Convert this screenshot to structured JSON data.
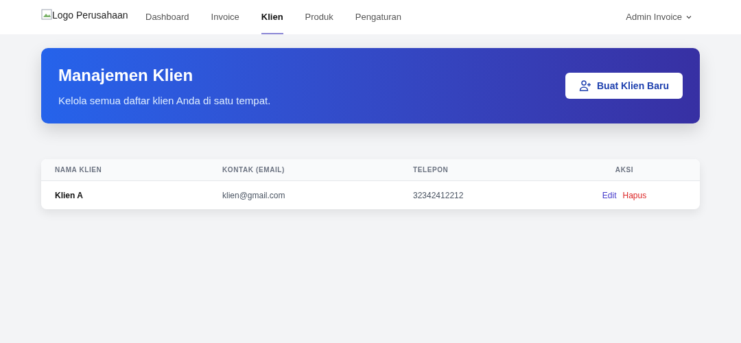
{
  "logo": {
    "alt_text": "Logo Perusahaan"
  },
  "nav": [
    {
      "label": "Dashboard",
      "selected": false
    },
    {
      "label": "Invoice",
      "selected": false
    },
    {
      "label": "Klien",
      "selected": true
    },
    {
      "label": "Produk",
      "selected": false
    },
    {
      "label": "Pengaturan",
      "selected": false
    }
  ],
  "user_menu": {
    "label": "Admin Invoice"
  },
  "header": {
    "title": "Manajemen Klien",
    "subtitle": "Kelola semua daftar klien Anda di satu tempat.",
    "button": "Buat Klien Baru"
  },
  "table": {
    "columns": [
      "NAMA KLIEN",
      "KONTAK (EMAIL)",
      "TELEPON",
      "AKSI"
    ],
    "rows": [
      {
        "name": "Klien A",
        "email": "klien@gmail.com",
        "phone": "32342412212",
        "actions": [
          {
            "label": "Edit",
            "kind": "edit"
          },
          {
            "label": "Hapus",
            "kind": "delete"
          }
        ]
      }
    ]
  }
}
